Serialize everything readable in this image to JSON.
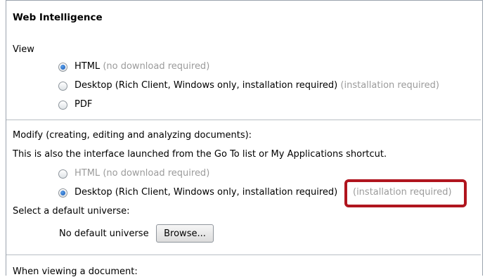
{
  "section_title": "Web Intelligence",
  "view": {
    "label": "View",
    "options": [
      {
        "label": "HTML",
        "hint": "(no download required)",
        "selected": true
      },
      {
        "label": "Desktop (Rich Client, Windows only, installation required)",
        "hint": "(installation required)",
        "selected": false
      },
      {
        "label": "PDF",
        "hint": "",
        "selected": false
      }
    ]
  },
  "modify": {
    "label": "Modify (creating, editing and analyzing documents):",
    "note": "This is also the interface launched from the Go To list or My Applications shortcut.",
    "options": [
      {
        "label": "HTML",
        "hint": "(no download required)",
        "selected": false
      },
      {
        "label": "Desktop (Rich Client, Windows only, installation required)",
        "hint": "(installation required)",
        "selected": true
      }
    ]
  },
  "universe": {
    "label": "Select a default universe:",
    "value": "No default universe",
    "browse_label": "Browse..."
  },
  "viewing_label": "When viewing a document:"
}
